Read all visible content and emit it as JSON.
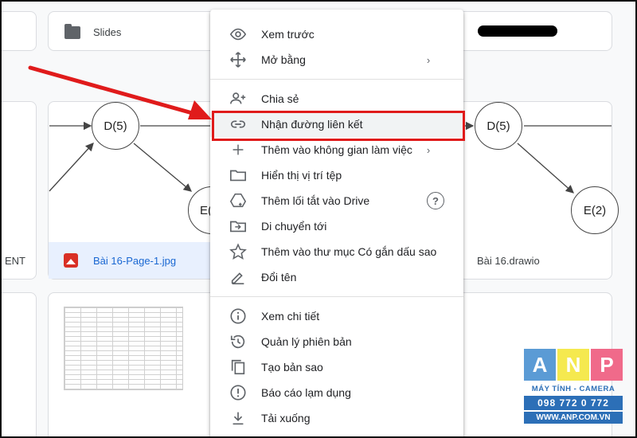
{
  "background": {
    "folder_name": "Slides",
    "file_left_partial": "ENT",
    "file_selected": "Bài 16-Page-1.jpg",
    "file_right": "Bài 16.drawio",
    "node_d_left": "D(5)",
    "node_e_left": "E(",
    "node_d_right": "D(5)",
    "node_e_right": "E(2)"
  },
  "menu": {
    "items": [
      {
        "label": "Xem trước",
        "icon": "eye-icon"
      },
      {
        "label": "Mở bằng",
        "icon": "move-arrows-icon",
        "chevron": "›"
      },
      {
        "label": "Chia sẻ",
        "icon": "person-add-icon"
      },
      {
        "label": "Nhận đường liên kết",
        "icon": "link-icon"
      },
      {
        "label": "Thêm vào không gian làm việc",
        "icon": "plus-icon",
        "chevron": "›"
      },
      {
        "label": "Hiển thị vị trí tệp",
        "icon": "folder-outline-icon"
      },
      {
        "label": "Thêm lối tắt vào Drive",
        "icon": "drive-shortcut-icon",
        "help": "?"
      },
      {
        "label": "Di chuyển tới",
        "icon": "move-to-folder-icon"
      },
      {
        "label": "Thêm vào thư mục Có gắn dấu sao",
        "icon": "star-outline-icon"
      },
      {
        "label": "Đổi tên",
        "icon": "pencil-icon"
      },
      {
        "label": "Xem chi tiết",
        "icon": "info-icon"
      },
      {
        "label": "Quản lý phiên bản",
        "icon": "history-icon"
      },
      {
        "label": "Tạo bản sao",
        "icon": "copy-icon"
      },
      {
        "label": "Báo cáo lạm dụng",
        "icon": "report-icon"
      },
      {
        "label": "Tải xuống",
        "icon": "download-icon"
      }
    ]
  },
  "watermark": {
    "letters": [
      "A",
      "N",
      "P"
    ],
    "tagline": "MÁY TÍNH - CAMERA",
    "phone": "098 772 0 772",
    "website": "WWW.ANP.COM.VN"
  },
  "colors": {
    "highlight_border": "#e01b1b",
    "arrow": "#e01b1b",
    "anp_a": "#5b9bd5",
    "anp_n": "#f5e94f",
    "anp_p": "#f06a8a",
    "anp_blue": "#2c6fb7"
  }
}
